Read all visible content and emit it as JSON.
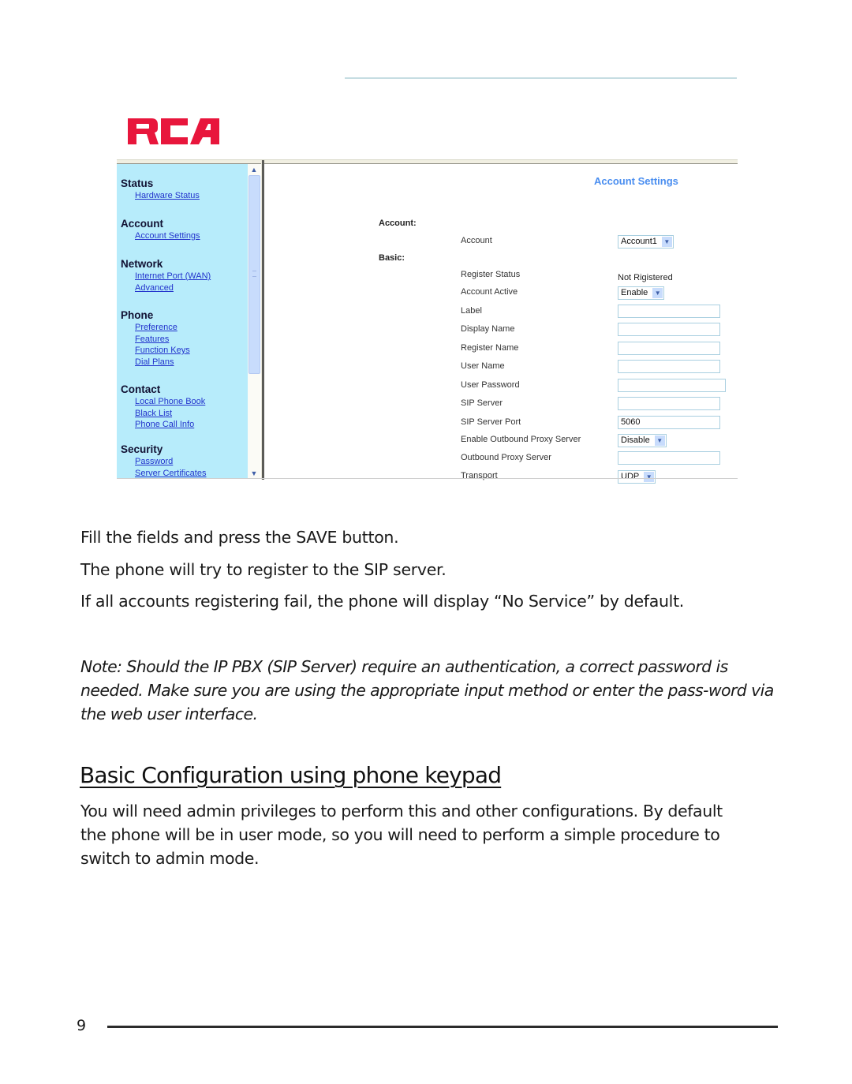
{
  "screenshot": {
    "brand": "RCA",
    "brand_color": "#e8163c",
    "sidebar": {
      "groups": [
        {
          "heading": "Status",
          "links": [
            "Hardware Status"
          ]
        },
        {
          "heading": "Account",
          "links": [
            "Account Settings"
          ]
        },
        {
          "heading": "Network",
          "links": [
            "Internet Port (WAN)",
            "Advanced"
          ]
        },
        {
          "heading": "Phone",
          "links": [
            "Preference",
            "Features",
            "Function Keys",
            "Dial Plans"
          ]
        },
        {
          "heading": "Contact",
          "links": [
            "Local Phone Book",
            "Black List",
            "Phone Call Info"
          ]
        },
        {
          "heading": "Security",
          "links": [
            "Password",
            "Server Certificates"
          ]
        }
      ],
      "scroll_up": "▲",
      "scroll_down": "▼"
    },
    "content": {
      "title": "Account Settings",
      "section_account": "Account:",
      "section_basic": "Basic:",
      "rows": [
        {
          "label": "Account",
          "type": "select",
          "value": "Account1"
        },
        {
          "label": "Register Status",
          "type": "text",
          "value": "Not Rigistered"
        },
        {
          "label": "Account Active",
          "type": "select",
          "value": "Enable"
        },
        {
          "label": "Label",
          "type": "input",
          "value": ""
        },
        {
          "label": "Display Name",
          "type": "input",
          "value": ""
        },
        {
          "label": "Register Name",
          "type": "input",
          "value": ""
        },
        {
          "label": "User Name",
          "type": "input",
          "value": ""
        },
        {
          "label": "User Password",
          "type": "password",
          "value": ""
        },
        {
          "label": "SIP Server",
          "type": "input",
          "value": ""
        },
        {
          "label": "SIP Server Port",
          "type": "input",
          "value": "5060"
        },
        {
          "label": "Enable Outbound Proxy Server",
          "type": "select",
          "value": "Disable"
        },
        {
          "label": "Outbound Proxy Server",
          "type": "input",
          "value": ""
        },
        {
          "label": "Transport",
          "type": "select",
          "value": "UDP"
        }
      ],
      "dropdown_arrow": "▼"
    }
  },
  "doc": {
    "line1": "Fill the fields and press the SAVE button.",
    "line2": "The phone will try to register to the SIP server.",
    "line3": "If all accounts registering fail, the phone will display “No Service” by default.",
    "note": "Note: Should the IP PBX (SIP Server) require an authentication, a correct password is needed. Make sure you are using the appropriate input method or enter the pass-word via the web user interface.",
    "heading": "Basic Configuration using phone keypad",
    "paragraph": "You will need admin privileges to perform this and other configurations. By default the phone will be in user mode, so you will need to perform a simple procedure to switch to admin mode.",
    "page_number": "9"
  }
}
